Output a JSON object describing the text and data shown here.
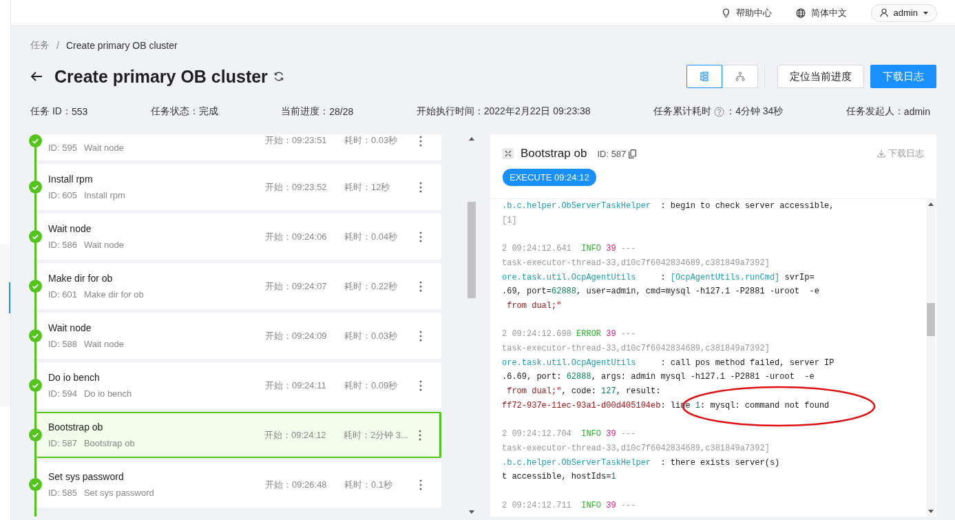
{
  "topbar": {
    "help": "帮助中心",
    "language": "简体中文",
    "user": "admin"
  },
  "breadcrumb": {
    "separator": "/",
    "items": [
      {
        "label": "任务",
        "current": false
      },
      {
        "label": "Create primary OB cluster",
        "current": true
      }
    ]
  },
  "title": "Create primary OB cluster",
  "view_toggle": [
    {
      "kind": "list",
      "selected": true
    },
    {
      "kind": "tree",
      "selected": false
    }
  ],
  "actions": [
    {
      "label": "定位当前进度",
      "primary": false
    },
    {
      "label": "下载日志",
      "primary": true
    }
  ],
  "info": [
    {
      "kind": "plain",
      "label": "任务 ID：",
      "value": "553"
    },
    {
      "kind": "plain",
      "label": "任务状态：",
      "value": "完成"
    },
    {
      "kind": "plain",
      "label": "当前进度：",
      "value": "28/28"
    },
    {
      "kind": "plain",
      "label": "开始执行时间：",
      "value": "2022年2月22日 09:23:38"
    },
    {
      "kind": "with_help",
      "label": "任务累计耗时",
      "value": "：4分钟 34秒"
    },
    {
      "kind": "plain",
      "label": "任务发起人：",
      "value": "admin"
    }
  ],
  "tasks": [
    {
      "id": "ID: 595",
      "name": "Wait node",
      "start": "开始：09:23:51",
      "duration": "耗时：0.03秒",
      "selected": false
    },
    {
      "title": "Install rpm",
      "id": "ID: 605",
      "name": "Install rpm",
      "start": "开始：09:23:52",
      "duration": "耗时：12秒",
      "selected": false
    },
    {
      "title": "Wait node",
      "id": "ID: 586",
      "name": "Wait node",
      "start": "开始：09:24:06",
      "duration": "耗时：0.04秒",
      "selected": false
    },
    {
      "title": "Make dir for ob",
      "id": "ID: 601",
      "name": "Make dir for ob",
      "start": "开始：09:24:07",
      "duration": "耗时：0.22秒",
      "selected": false
    },
    {
      "title": "Wait node",
      "id": "ID: 588",
      "name": "Wait node",
      "start": "开始：09:24:09",
      "duration": "耗时：0.03秒",
      "selected": false
    },
    {
      "title": "Do io bench",
      "id": "ID: 594",
      "name": "Do io bench",
      "start": "开始：09:24:11",
      "duration": "耗时：0.09秒",
      "selected": false
    },
    {
      "title": "Bootstrap ob",
      "id": "ID: 587",
      "name": "Bootstrap ob",
      "start": "开始：09:24:12",
      "duration": "耗时：2分钟 3...",
      "selected": true
    },
    {
      "title": "Set sys password",
      "id": "ID: 585",
      "name": "Set sys password",
      "start": "开始：09:26:48",
      "duration": "耗时：0.1秒",
      "selected": false
    }
  ],
  "detail": {
    "title": "Bootstrap ob",
    "id": "ID: 587",
    "download": "下载日志",
    "badge": "EXECUTE 09:24:12",
    "log": [
      [
        [
          {
            "kind": "logger",
            "text": ".b.c.helper.ObServerTaskHelper"
          },
          {
            "kind": "message",
            "text": "  : begin to check server accessible,"
          }
        ],
        [
          {
            "kind": "meta",
            "text": "[1]"
          }
        ]
      ],
      [
        [
          {
            "kind": "meta",
            "text": "2 09:24:12.641  "
          },
          {
            "kind": "level",
            "text": "INFO"
          },
          {
            "kind": "thread",
            "text": " 39"
          },
          {
            "kind": "meta",
            "text": " ---"
          }
        ],
        [
          {
            "kind": "meta",
            "text": "task-executor-thread-33,d10c7f6042834689,c381849a7392]"
          }
        ],
        [
          {
            "kind": "logger",
            "text": "ore.task.util.OcpAgentUtils"
          },
          {
            "kind": "message",
            "text": "     : "
          },
          {
            "kind": "logger",
            "text": "[OcpAgentUtils.runCmd]"
          },
          {
            "kind": "message",
            "text": " svrIp="
          }
        ],
        [
          {
            "kind": "message",
            "text": ".69, port="
          },
          {
            "kind": "number",
            "text": "62888"
          },
          {
            "kind": "message",
            "text": ", user=admin, cmd=mysql -h127.1 -P2881 -uroot  -e"
          }
        ],
        [
          {
            "kind": "string",
            "text": " from dual;\""
          }
        ]
      ],
      [
        [
          {
            "kind": "meta",
            "text": "2 09:24:12.698 "
          },
          {
            "kind": "level",
            "text": "ERROR"
          },
          {
            "kind": "thread",
            "text": " 39"
          },
          {
            "kind": "meta",
            "text": " ---"
          }
        ],
        [
          {
            "kind": "meta",
            "text": "task-executor-thread-33,d10c7f6042834689,c381849a7392]"
          }
        ],
        [
          {
            "kind": "logger",
            "text": "ore.task.util.OcpAgentUtils"
          },
          {
            "kind": "message",
            "text": "     : call pos method failed, server IP"
          }
        ],
        [
          {
            "kind": "message",
            "text": ".6.69, port: "
          },
          {
            "kind": "number",
            "text": "62888"
          },
          {
            "kind": "message",
            "text": ", args: admin mysql -h127.1 -P2881 -uroot  -e"
          }
        ],
        [
          {
            "kind": "string",
            "text": " from dual;\""
          },
          {
            "kind": "message",
            "text": ", code: "
          },
          {
            "kind": "number",
            "text": "127"
          },
          {
            "kind": "message",
            "text": ", result:"
          }
        ],
        [
          {
            "kind": "string",
            "text": "ff72-937e-11ec-93a1-d00d405104eb"
          },
          {
            "kind": "message",
            "text": ": line "
          },
          {
            "kind": "number",
            "text": "1"
          },
          {
            "kind": "message",
            "text": ": mysql: command not found"
          }
        ]
      ],
      [
        [
          {
            "kind": "meta",
            "text": "2 09:24:12.704  "
          },
          {
            "kind": "level",
            "text": "INFO"
          },
          {
            "kind": "thread",
            "text": " 39"
          },
          {
            "kind": "meta",
            "text": " ---"
          }
        ],
        [
          {
            "kind": "meta",
            "text": "task-executor-thread-33,d10c7f6042834689,c381849a7392]"
          }
        ],
        [
          {
            "kind": "logger",
            "text": ".b.c.helper.ObServerTaskHelper"
          },
          {
            "kind": "message",
            "text": "  : there exists server(s)"
          }
        ],
        [
          {
            "kind": "message",
            "text": "t accessible, hostIds="
          },
          {
            "kind": "number",
            "text": "1"
          }
        ]
      ],
      [
        [
          {
            "kind": "meta",
            "text": "2 09:24:12.711  "
          },
          {
            "kind": "level",
            "text": "INFO"
          },
          {
            "kind": "thread",
            "text": " 39"
          },
          {
            "kind": "meta",
            "text": " ---"
          }
        ]
      ]
    ]
  }
}
